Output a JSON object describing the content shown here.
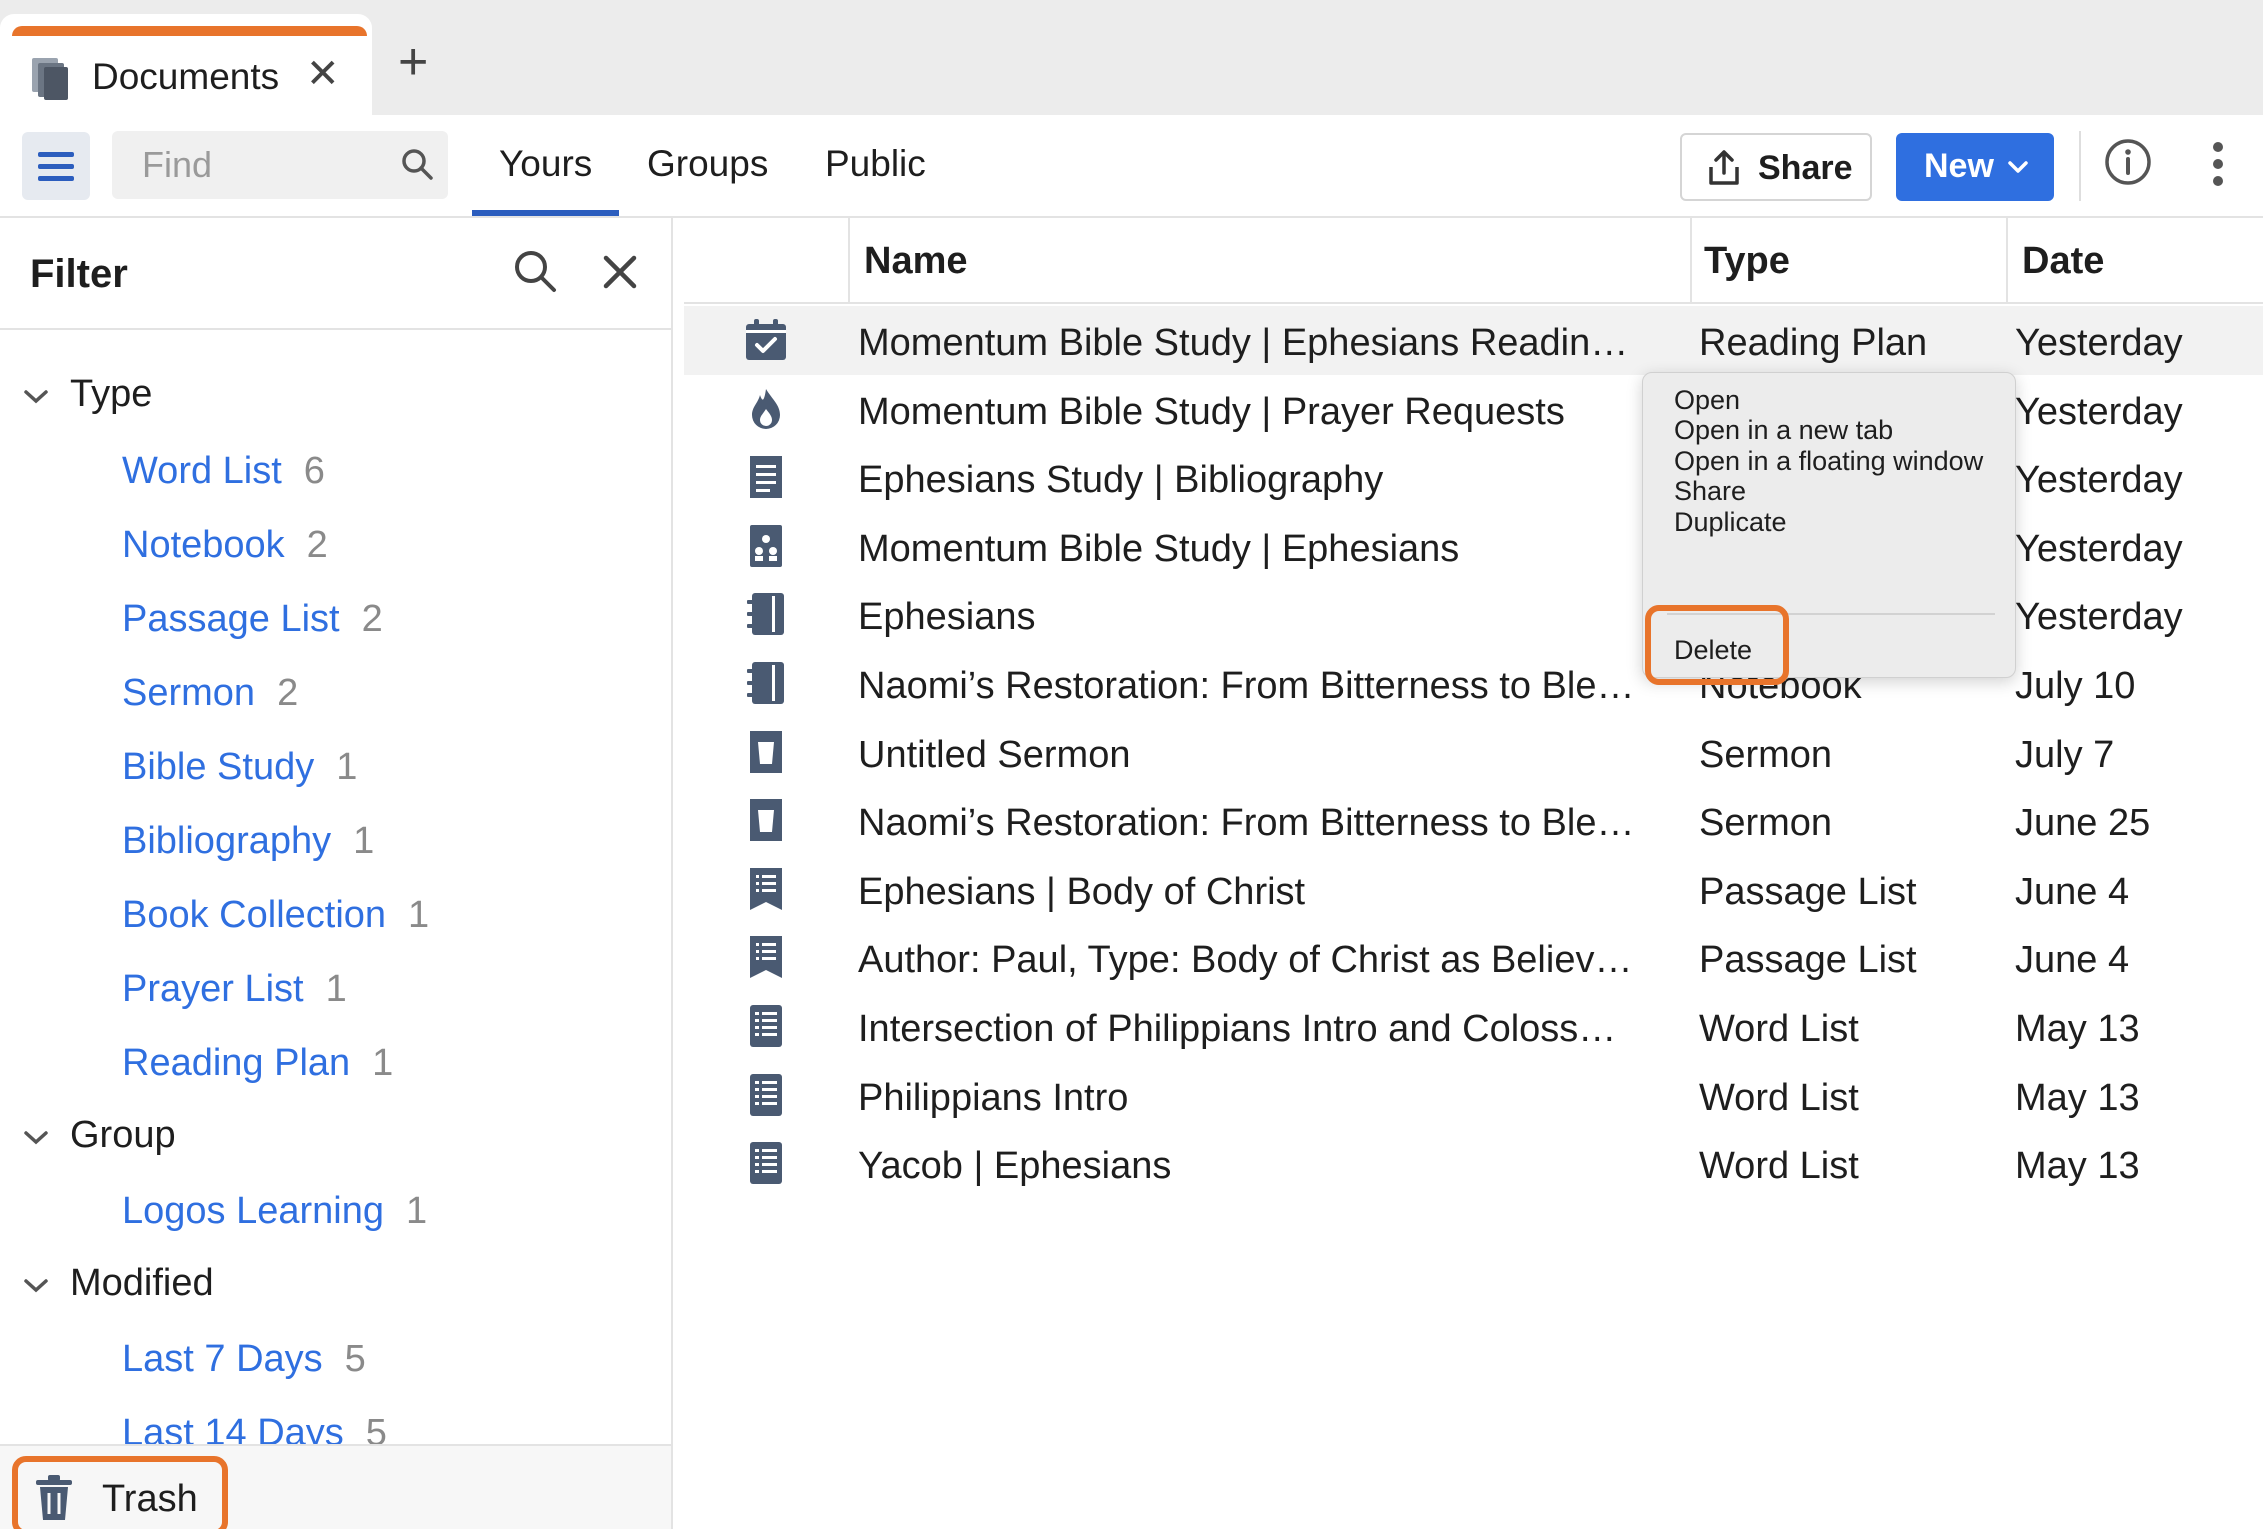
{
  "tabs": {
    "active_label": "Documents",
    "close_glyph": "✕",
    "new_tab_glyph": "+"
  },
  "toolbar": {
    "find_placeholder": "Find",
    "nav": [
      "Yours",
      "Groups",
      "Public"
    ],
    "active_nav": "Yours",
    "share_label": "Share",
    "new_label": "New"
  },
  "filter": {
    "title": "Filter",
    "groups": [
      {
        "label": "Type",
        "items": [
          {
            "name": "Word List",
            "count": "6"
          },
          {
            "name": "Notebook",
            "count": "2"
          },
          {
            "name": "Passage List",
            "count": "2"
          },
          {
            "name": "Sermon",
            "count": "2"
          },
          {
            "name": "Bible Study",
            "count": "1"
          },
          {
            "name": "Bibliography",
            "count": "1"
          },
          {
            "name": "Book Collection",
            "count": "1"
          },
          {
            "name": "Prayer List",
            "count": "1"
          },
          {
            "name": "Reading Plan",
            "count": "1"
          }
        ]
      },
      {
        "label": "Group",
        "items": [
          {
            "name": "Logos Learning",
            "count": "1"
          }
        ]
      },
      {
        "label": "Modified",
        "items": [
          {
            "name": "Last 7 Days",
            "count": "5"
          },
          {
            "name": "Last 14 Days",
            "count": "5"
          }
        ]
      }
    ],
    "trash_label": "Trash"
  },
  "table": {
    "columns": [
      "Name",
      "Type",
      "Date"
    ],
    "rows": [
      {
        "icon": "reading-plan-icon",
        "name": "Momentum Bible Study | Ephesians Readin…",
        "type": "Reading Plan",
        "date": "Yesterday"
      },
      {
        "icon": "prayer-list-icon",
        "name": "Momentum Bible Study | Prayer Requests",
        "type": "",
        "date": "Yesterday"
      },
      {
        "icon": "bibliography-icon",
        "name": "Ephesians Study | Bibliography",
        "type": "",
        "date": "Yesterday"
      },
      {
        "icon": "bible-study-icon",
        "name": "Momentum Bible Study | Ephesians",
        "type": "",
        "date": "Yesterday"
      },
      {
        "icon": "notebook-icon",
        "name": "Ephesians",
        "type": "Notebook",
        "date": "Yesterday"
      },
      {
        "icon": "notebook-icon",
        "name": "Naomi’s Restoration: From Bitterness to Ble…",
        "type": "Notebook",
        "date": "July 10"
      },
      {
        "icon": "sermon-icon",
        "name": "Untitled Sermon",
        "type": "Sermon",
        "date": "July 7"
      },
      {
        "icon": "sermon-icon",
        "name": "Naomi’s Restoration: From Bitterness to Ble…",
        "type": "Sermon",
        "date": "June 25"
      },
      {
        "icon": "passage-list-icon",
        "name": "Ephesians | Body of Christ",
        "type": "Passage List",
        "date": "June 4"
      },
      {
        "icon": "passage-list-icon",
        "name": "Author: Paul, Type: Body of Christ as Believ…",
        "type": "Passage List",
        "date": "June 4"
      },
      {
        "icon": "word-list-icon",
        "name": "Intersection of Philippians Intro and Coloss…",
        "type": "Word List",
        "date": "May 13"
      },
      {
        "icon": "word-list-icon",
        "name": "Philippians Intro",
        "type": "Word List",
        "date": "May 13"
      },
      {
        "icon": "word-list-icon",
        "name": "Yacob | Ephesians",
        "type": "Word List",
        "date": "May 13"
      }
    ]
  },
  "context_menu": {
    "items": [
      "Open",
      "Open in a new tab",
      "Open in a floating window",
      "Share",
      "Duplicate"
    ],
    "delete_label": "Delete"
  },
  "colors": {
    "accent_blue": "#2f6fe0",
    "highlight_orange": "#e8742b",
    "icon_slate": "#4a5a72"
  }
}
